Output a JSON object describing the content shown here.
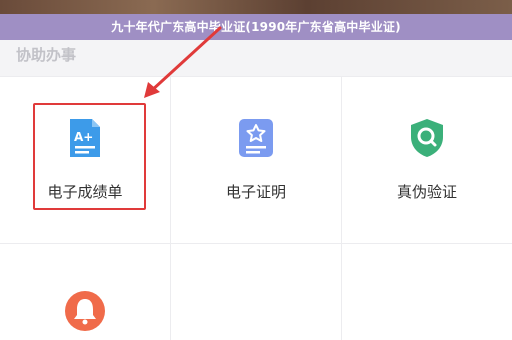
{
  "banner": {
    "title": "九十年代广东高中毕业证(1990年广东省高中毕业证)"
  },
  "section": {
    "title": "协助办事"
  },
  "services": [
    {
      "label": "电子成绩单",
      "icon": "report-card-icon",
      "color": "#3d9be9"
    },
    {
      "label": "电子证明",
      "icon": "certificate-star-icon",
      "color": "#7b9bf0"
    },
    {
      "label": "真伪验证",
      "icon": "shield-search-icon",
      "color": "#3bb07a"
    },
    {
      "label": "",
      "icon": "bell-icon",
      "color": "#f06b4a"
    }
  ],
  "annotation": {
    "highlight_color": "#e03a3a"
  }
}
